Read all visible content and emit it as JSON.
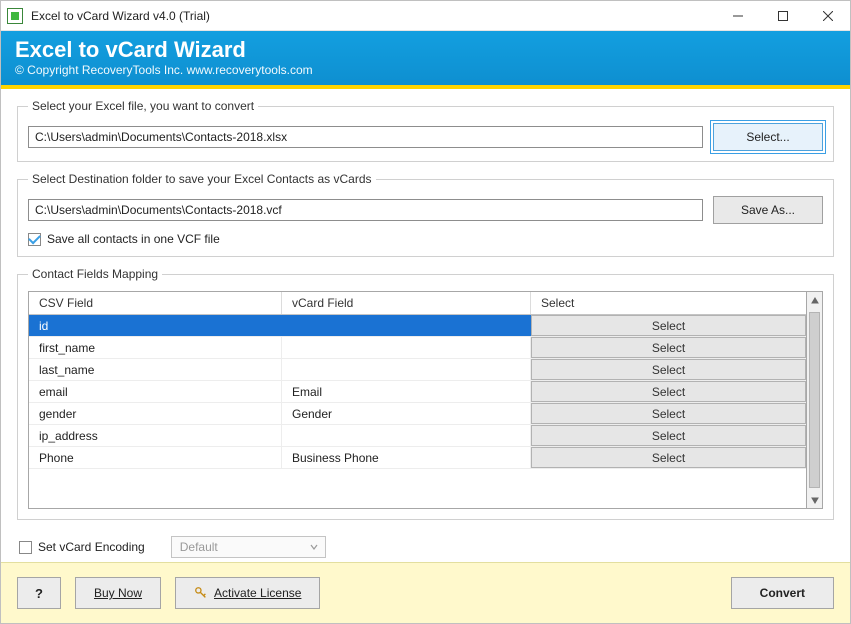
{
  "title": "Excel to vCard Wizard v4.0 (Trial)",
  "banner": {
    "heading": "Excel to vCard Wizard",
    "copyright": "© Copyright RecoveryTools Inc. www.recoverytools.com"
  },
  "source": {
    "legend": "Select your Excel file, you want to convert",
    "path": "C:\\Users\\admin\\Documents\\Contacts-2018.xlsx",
    "button": "Select..."
  },
  "dest": {
    "legend": "Select Destination folder to save your Excel Contacts as vCards",
    "path": "C:\\Users\\admin\\Documents\\Contacts-2018.vcf",
    "button": "Save As...",
    "single_vcf_label": "Save all contacts in one VCF file",
    "single_vcf_checked": true
  },
  "mapping": {
    "legend": "Contact Fields Mapping",
    "headers": {
      "csv": "CSV Field",
      "vcard": "vCard Field",
      "select": "Select"
    },
    "select_btn": "Select",
    "rows": [
      {
        "csv": "id",
        "vcard": "",
        "selected": true
      },
      {
        "csv": "first_name",
        "vcard": "",
        "selected": false
      },
      {
        "csv": "last_name",
        "vcard": "",
        "selected": false
      },
      {
        "csv": "email",
        "vcard": "Email",
        "selected": false
      },
      {
        "csv": "gender",
        "vcard": "Gender",
        "selected": false
      },
      {
        "csv": "ip_address",
        "vcard": "",
        "selected": false
      },
      {
        "csv": "Phone",
        "vcard": "Business Phone",
        "selected": false
      }
    ]
  },
  "encoding": {
    "checkbox_label": "Set vCard Encoding",
    "checked": false,
    "value": "Default"
  },
  "footer": {
    "help": "?",
    "buy": "Buy Now",
    "activate": "Activate License",
    "convert": "Convert"
  }
}
